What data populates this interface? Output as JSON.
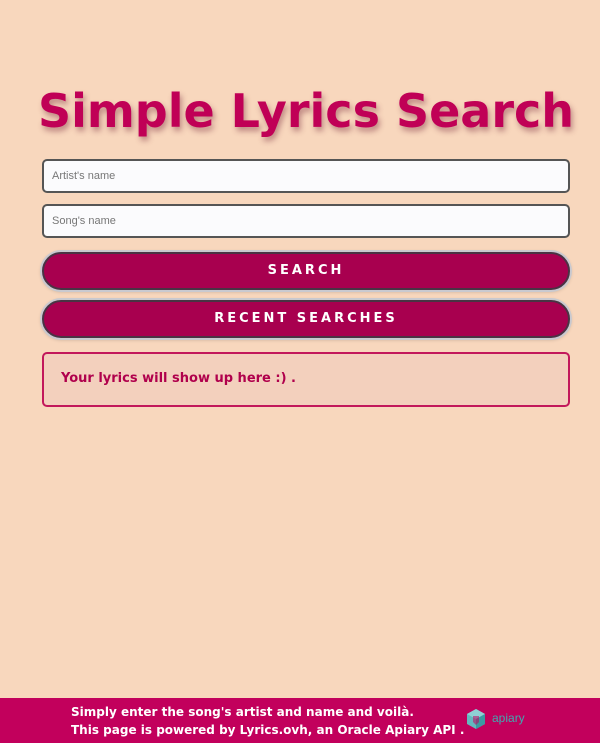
{
  "header": {
    "title": "Simple Lyrics Search"
  },
  "form": {
    "artist_placeholder": "Artist's name",
    "artist_value": "",
    "song_placeholder": "Song's name",
    "song_value": "",
    "search_label": "SEARCH",
    "recent_label": "RECENT SEARCHES"
  },
  "lyrics": {
    "text": "Your lyrics will show up here :) ."
  },
  "footer": {
    "line1": "Simply enter the song's artist and name and voilà.",
    "line2": "This page is powered by Lyrics.ovh, an Oracle Apiary API .",
    "logo_icon": "apiary-logo-icon",
    "logo_text": "apiary"
  },
  "colors": {
    "background": "#f8d7bd",
    "accent": "#c00056",
    "button": "#a8004f",
    "footer": "#c2005c",
    "logo": "#3fa9b0"
  }
}
